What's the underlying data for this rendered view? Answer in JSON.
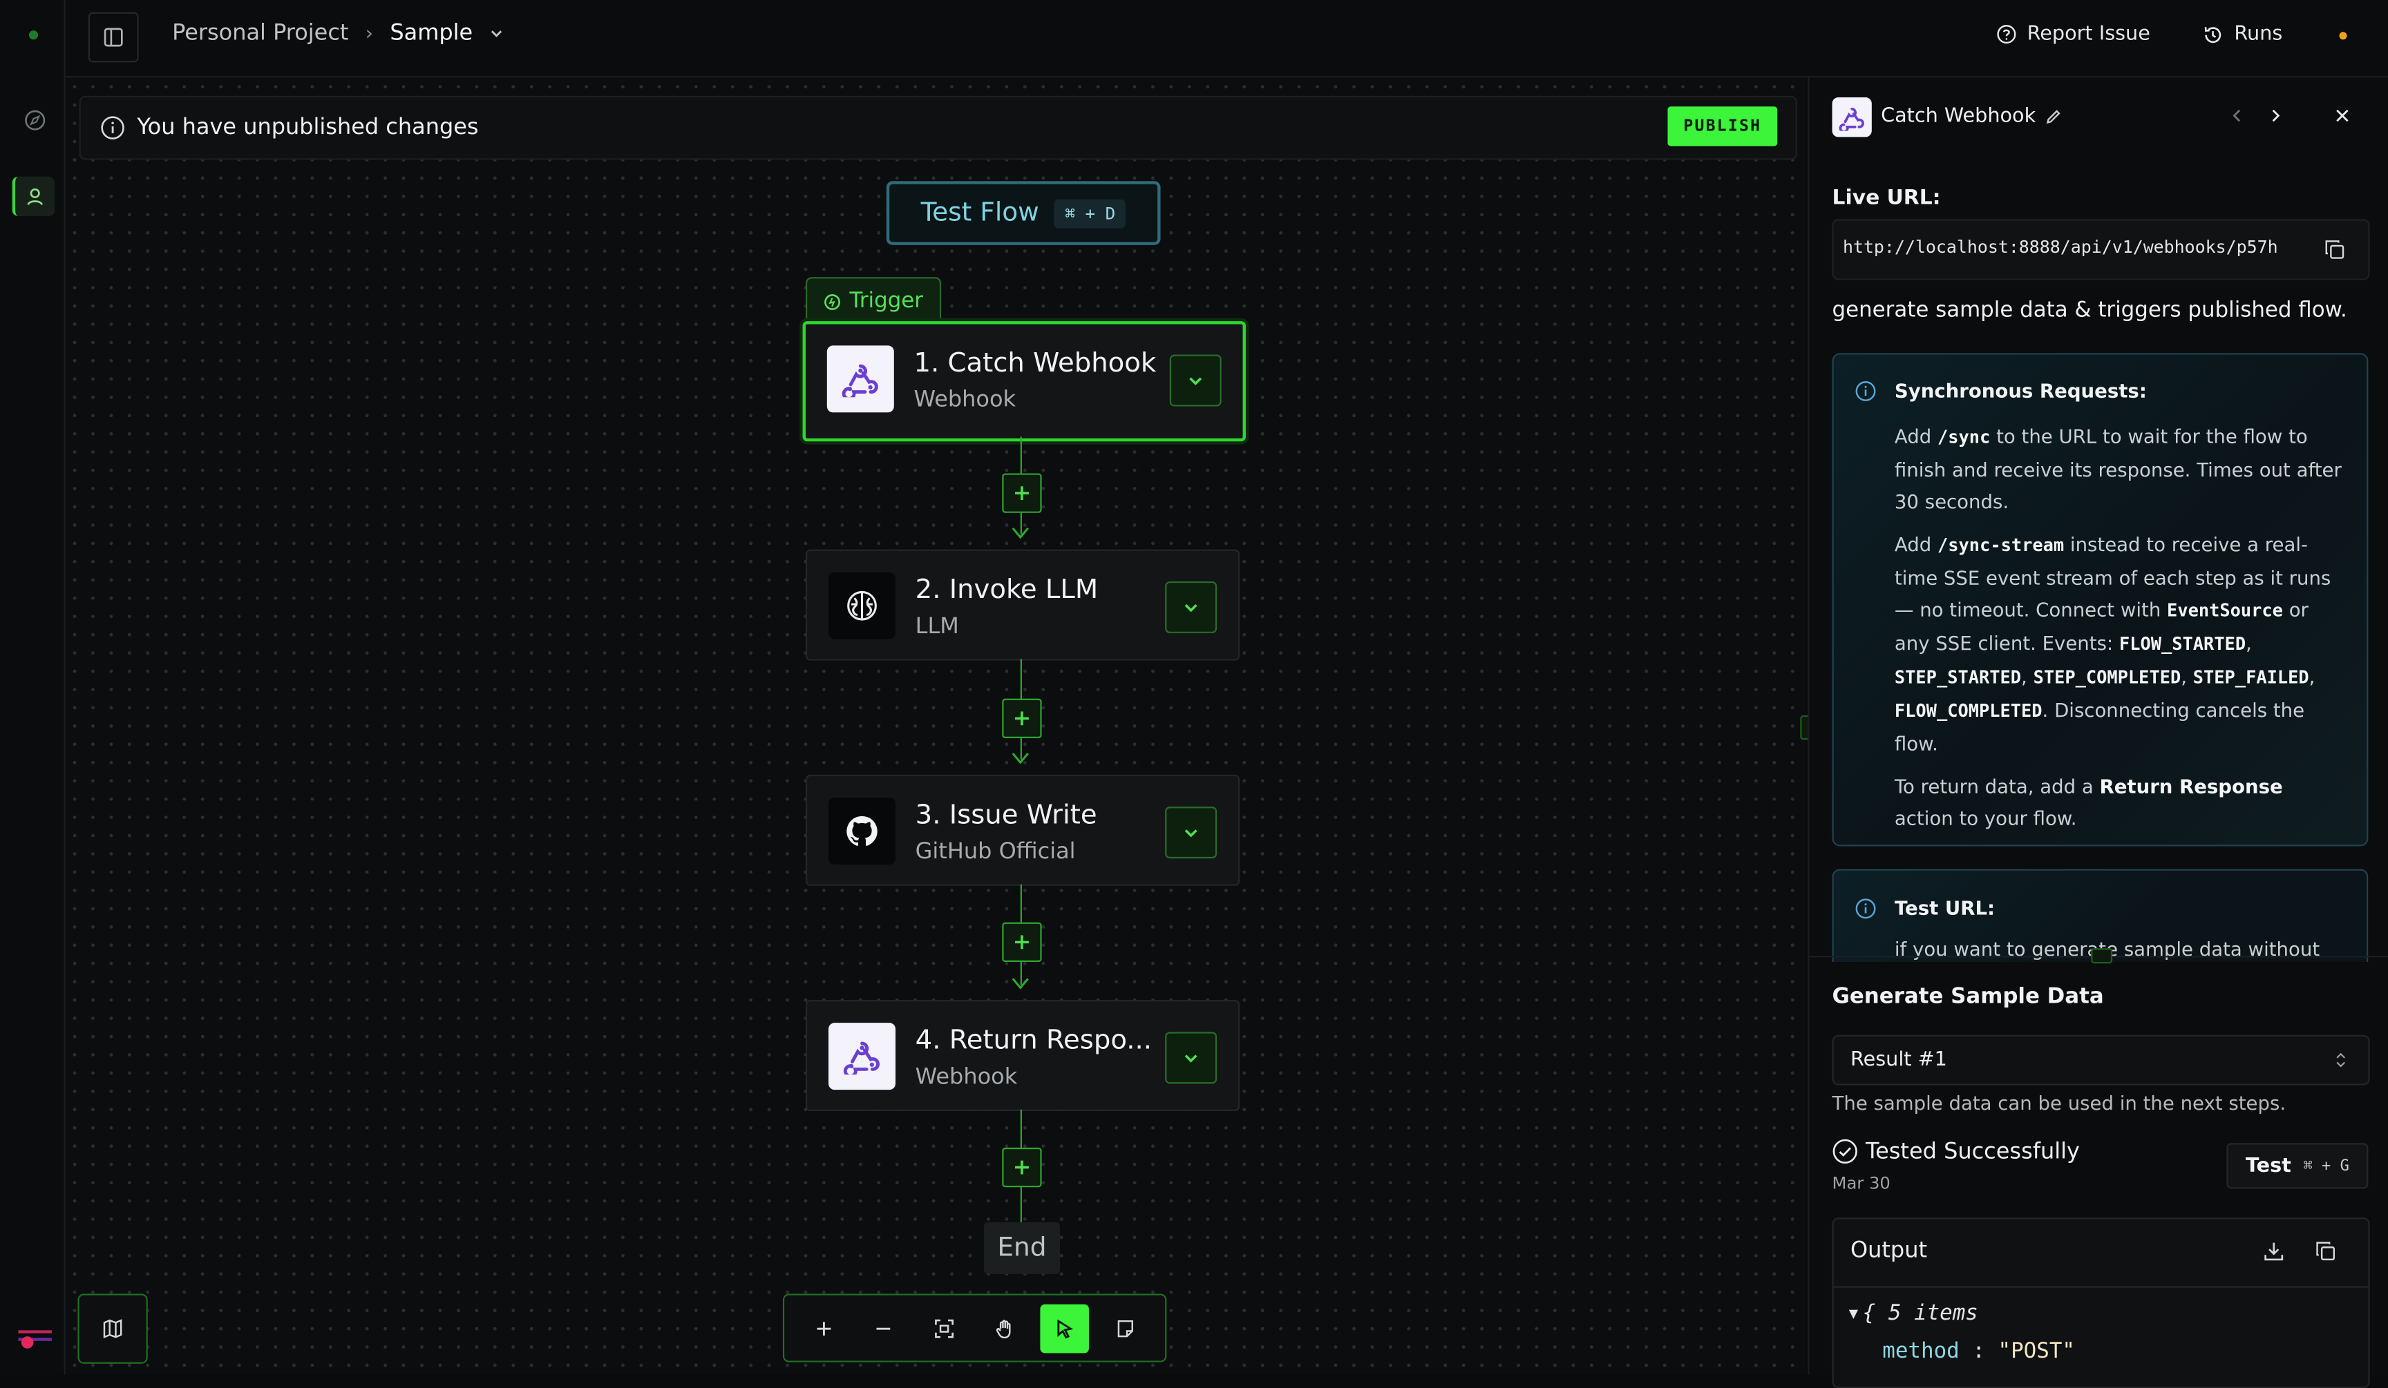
{
  "breadcrumb": {
    "project": "Personal Project",
    "flow": "Sample"
  },
  "topbar": {
    "report_issue": "Report Issue",
    "runs": "Runs"
  },
  "banner": {
    "text": "You have unpublished changes",
    "publish": "PUBLISH"
  },
  "test_flow": {
    "label": "Test Flow",
    "shortcut": "⌘ + D"
  },
  "trigger_tag": "Trigger",
  "nodes": [
    {
      "title": "1. Catch Webhook",
      "subtitle": "Webhook"
    },
    {
      "title": "2. Invoke LLM",
      "subtitle": "LLM"
    },
    {
      "title": "3. Issue Write",
      "subtitle": "GitHub Official"
    },
    {
      "title": "4. Return Respo...",
      "subtitle": "Webhook"
    }
  ],
  "end_label": "End",
  "panel": {
    "title": "Catch Webhook",
    "live_url_label": "Live URL:",
    "live_url": "http://localhost:8888/api/v1/webhooks/p57h",
    "description": "generate sample data & triggers published flow.",
    "sync": {
      "heading": "Synchronous Requests:",
      "p1_a": "Add ",
      "p1_code": "/sync",
      "p1_b": " to the URL to wait for the flow to finish and receive its response. Times out after 30 seconds.",
      "p2_a": "Add ",
      "p2_code": "/sync-stream",
      "p2_b": " instead to receive a real-time SSE event stream of each step as it runs — no timeout. Connect with ",
      "p2_code2": "EventSource",
      "p2_c": " or any SSE client. Events: ",
      "ev1": "FLOW_STARTED",
      "ev2": "STEP_STARTED",
      "ev3": "STEP_COMPLETED",
      "ev4": "STEP_FAILED",
      "ev5": "FLOW_COMPLETED",
      "p2_d": ". Disconnecting cancels the flow.",
      "p3_a": "To return data, add a ",
      "p3_b": "Return Response",
      "p3_c": " action to your flow."
    },
    "test_url": {
      "heading": "Test URL:",
      "text": "if you want to generate sample data without"
    },
    "generate": {
      "heading": "Generate Sample Data",
      "select_value": "Result #1",
      "hint": "The sample data can be used in the next steps.",
      "status": "Tested Successfully",
      "date": "Mar 30",
      "test_button": "Test",
      "test_shortcut": "⌘ + G"
    },
    "output": {
      "label": "Output",
      "items": "{ 5 items",
      "key": "method",
      "value": "\"POST\""
    }
  },
  "colors": {
    "accent": "#3cf53b",
    "node_border": "#2fd62e",
    "info_border": "#214352"
  }
}
